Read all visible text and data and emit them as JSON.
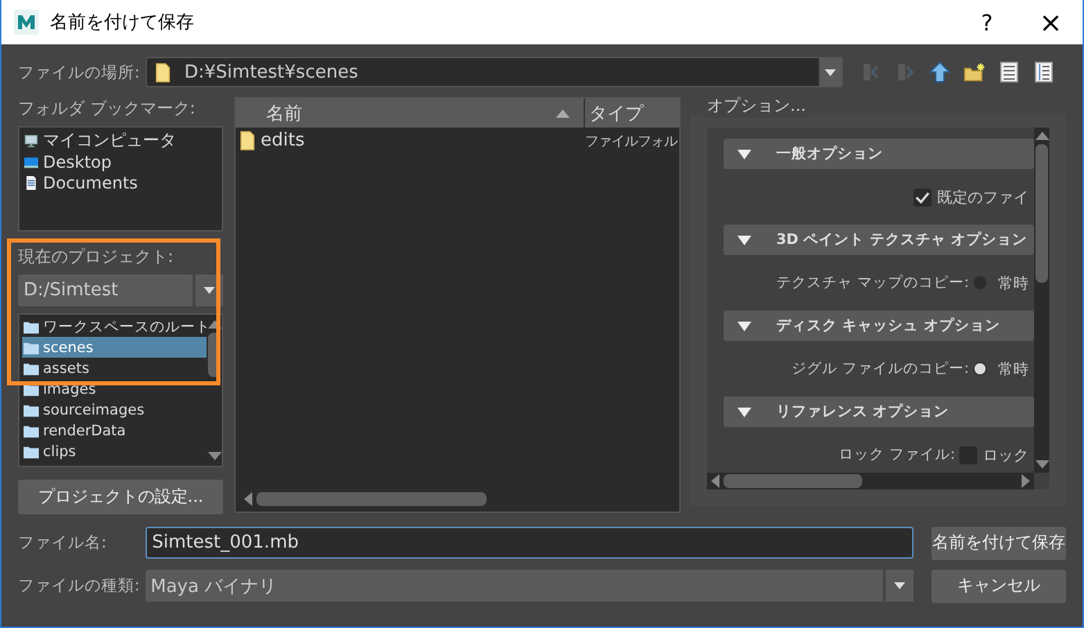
{
  "window": {
    "title": "名前を付けて保存",
    "help": "?",
    "close": "×"
  },
  "location": {
    "label": "ファイルの場所:",
    "value": "D:¥Simtest¥scenes"
  },
  "bookmarks": {
    "label": "フォルダ ブックマーク:",
    "items": [
      {
        "label": "マイコンピュータ",
        "kind": "computer"
      },
      {
        "label": "Desktop",
        "kind": "desktop"
      },
      {
        "label": "Documents",
        "kind": "document"
      }
    ]
  },
  "project": {
    "label": "現在のプロジェクト:",
    "value": "D:/Simtest",
    "folders": [
      {
        "label": "ワークスペースのルート",
        "selected": false
      },
      {
        "label": "scenes",
        "selected": true
      },
      {
        "label": "assets",
        "selected": false
      },
      {
        "label": "images",
        "selected": false
      },
      {
        "label": "sourceimages",
        "selected": false
      },
      {
        "label": "renderData",
        "selected": false
      },
      {
        "label": "clips",
        "selected": false
      }
    ],
    "settings_button": "プロジェクトの設定..."
  },
  "files": {
    "columns": [
      "名前",
      "タイプ"
    ],
    "rows": [
      {
        "name": "edits",
        "type": "ファイルフォル"
      }
    ]
  },
  "options": {
    "label": "オプション...",
    "sections": [
      {
        "title": "一般オプション",
        "expanded": true,
        "rows": [
          {
            "kind": "checkbox",
            "label": "既定のファイ",
            "checked": true
          }
        ]
      },
      {
        "title": "3D ペイント テクスチャ オプション",
        "expanded": true,
        "rows": [
          {
            "kind": "radio",
            "caption": "テクスチャ マップのコピー:",
            "label": "常時",
            "selected": false
          }
        ]
      },
      {
        "title": "ディスク キャッシュ オプション",
        "expanded": true,
        "rows": [
          {
            "kind": "radio",
            "caption": "ジグル ファイルのコピー:",
            "label": "常時",
            "selected": true
          }
        ]
      },
      {
        "title": "リファレンス オプション",
        "expanded": true,
        "rows": [
          {
            "kind": "checkbox",
            "caption": "ロック ファイル:",
            "label": "ロック",
            "checked": false
          }
        ]
      }
    ]
  },
  "filename": {
    "label": "ファイル名:",
    "value": "Simtest_001.mb"
  },
  "filetype": {
    "label": "ファイルの種類:",
    "value": "Maya バイナリ"
  },
  "buttons": [
    "名前を付けて保存",
    "キャンセル"
  ]
}
